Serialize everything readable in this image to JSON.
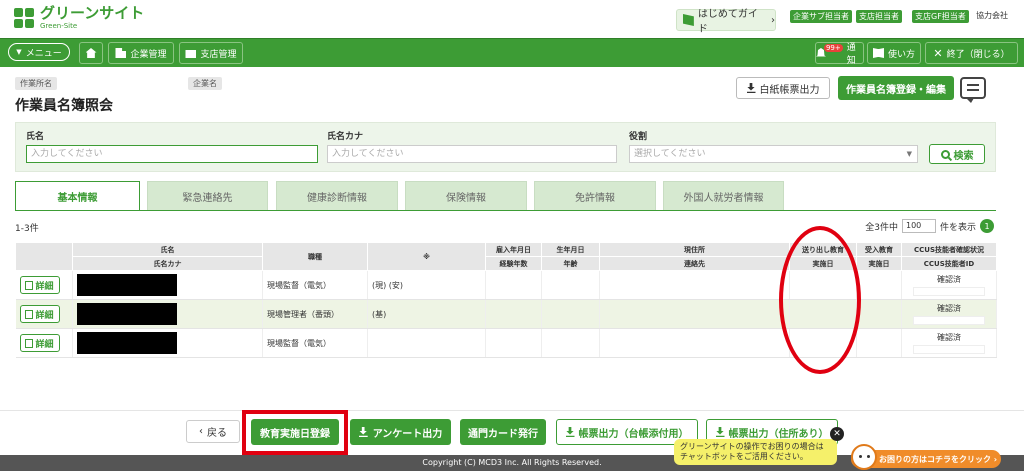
{
  "header": {
    "logo_main": "グリーンサイト",
    "logo_sub": "Green-Site",
    "guide_label": "はじめてガイド",
    "role_tags": [
      "企業サブ担当者",
      "支店担当者",
      "支店GF担当者"
    ],
    "partner_label": "協力会社"
  },
  "nav": {
    "menu_label": "メニュー",
    "company_mgmt": "企業管理",
    "branch_mgmt": "支店管理",
    "notify_count": "99+",
    "notify_label": "通知",
    "howto_label": "使い方",
    "exit_label": "終了（閉じる）"
  },
  "page": {
    "site_tag": "作業所名",
    "company_tag": "企業名",
    "title": "作業員名簿照会",
    "blank_form_label": "白紙帳票出力",
    "register_edit_label": "作業員名簿登録・編集"
  },
  "search": {
    "name_label": "氏名",
    "name_placeholder": "入力してください",
    "kana_label": "氏名カナ",
    "kana_placeholder": "入力してください",
    "role_label": "役割",
    "role_placeholder": "選択してください",
    "search_label": "検索"
  },
  "tabs": [
    {
      "label": "基本情報"
    },
    {
      "label": "緊急連絡先"
    },
    {
      "label": "健康診断情報"
    },
    {
      "label": "保険情報"
    },
    {
      "label": "免許情報"
    },
    {
      "label": "外国人就労者情報"
    }
  ],
  "list": {
    "count_text": "1-3件",
    "total_text": "全3件中",
    "page_size": "100",
    "per_page_text": "件を表示",
    "page_number": "1"
  },
  "table": {
    "headers": {
      "name": "氏名",
      "name_kana": "氏名カナ",
      "job": "職種",
      "mark": "※",
      "hire_date": "雇入年月日",
      "experience": "経験年数",
      "birth_date": "生年月日",
      "age": "年齢",
      "address": "現住所",
      "contact": "連絡先",
      "send_edu_1": "送り出し教育",
      "send_edu_2": "実施日",
      "recv_edu_1": "受入教育",
      "recv_edu_2": "実施日",
      "ccus_status": "CCUS技能者確認状況",
      "ccus_id": "CCUS技能者ID"
    },
    "detail_label": "詳細",
    "rows": [
      {
        "job": "現場監督（電気）",
        "mark": "(現) (安)",
        "ccus": "確認済"
      },
      {
        "job": "現場管理者（番頭）",
        "mark": "(基)",
        "ccus": "確認済"
      },
      {
        "job": "現場監督（電気）",
        "mark": "",
        "ccus": "確認済"
      }
    ]
  },
  "actions": {
    "back_label": "戻る",
    "edu_date_label": "教育実施日登録",
    "survey_label": "アンケート出力",
    "gate_card_label": "通門カード発行",
    "form_ledger_label": "帳票出力（台帳添付用）",
    "form_address_label": "帳票出力（住所あり）"
  },
  "chatbot": {
    "bubble_line1": "グリーンサイトの操作でお困りの場合は",
    "bubble_line2": "チャットボットをご活用ください。",
    "helper_label": "お困りの方はコチラをクリック ›"
  },
  "footer": {
    "copyright": "Copyright (C) MCD3 Inc. All Rights Reserved."
  },
  "colors": {
    "brand_green": "#3d9c35",
    "annotation_red": "#e00010"
  }
}
